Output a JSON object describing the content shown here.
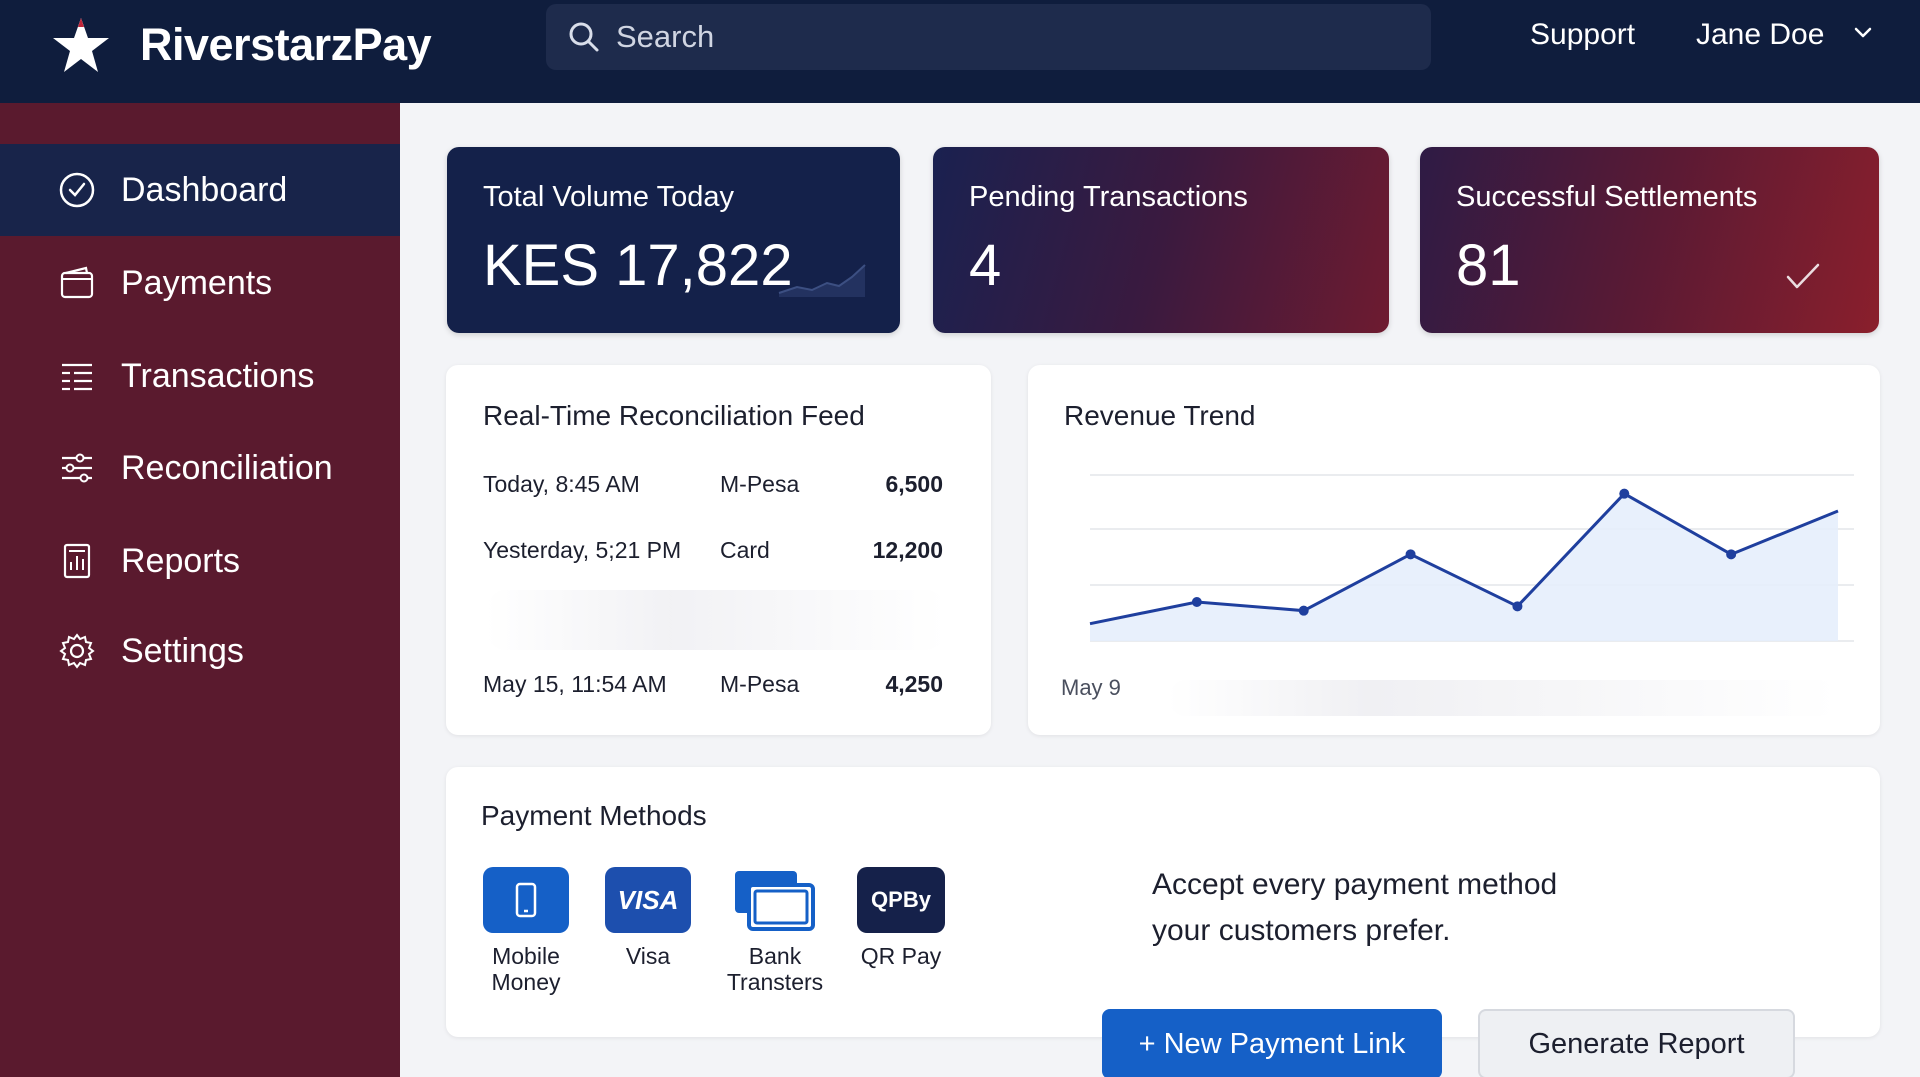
{
  "app": {
    "name": "RiverstarzPay"
  },
  "header": {
    "search_placeholder": "Search",
    "support_label": "Support",
    "user_name": "Jane Doe"
  },
  "sidebar": {
    "items": [
      {
        "label": "Dashboard",
        "icon": "check-circle-icon",
        "active": true
      },
      {
        "label": "Payments",
        "icon": "wallet-icon"
      },
      {
        "label": "Transactions",
        "icon": "list-icon"
      },
      {
        "label": "Reconciliation",
        "icon": "sliders-icon"
      },
      {
        "label": "Reports",
        "icon": "report-icon"
      },
      {
        "label": "Settings",
        "icon": "gear-icon"
      }
    ]
  },
  "stats": [
    {
      "title": "Total Volume Today",
      "value": "KES 17,822"
    },
    {
      "title": "Pending Transactions",
      "value": "4"
    },
    {
      "title": "Successful Settlements",
      "value": "81"
    }
  ],
  "feed": {
    "title": "Real-Time Reconciliation Feed",
    "rows": [
      {
        "time": "Today, 8:45 AM",
        "method": "M-Pesa",
        "amount": "6,500"
      },
      {
        "time": "Yesterday, 5;21 PM",
        "method": "Card",
        "amount": "12,200"
      },
      {
        "time": "May 15, 11:54 AM",
        "method": "M-Pesa",
        "amount": "4,250"
      }
    ]
  },
  "revenue": {
    "title": "Revenue Trend",
    "x_label": "May 9",
    "values": [
      2,
      4.5,
      3.5,
      10,
      4,
      17,
      10,
      15
    ]
  },
  "payment_methods": {
    "title": "Payment Methods",
    "items": [
      {
        "label_line1": "Mobile",
        "label_line2": "Money",
        "icon": "mobile-phone-icon"
      },
      {
        "label_line1": "Visa",
        "label_line2": "",
        "icon": "visa-icon",
        "badge": "VISA"
      },
      {
        "label_line1": "Bank",
        "label_line2": "Transters",
        "icon": "bank-cards-icon"
      },
      {
        "label_line1": "QR Pay",
        "label_line2": "",
        "icon": "qr-pay-icon",
        "badge": "QPBy"
      }
    ],
    "tagline_line1": "Accept every payment method",
    "tagline_line2": "your customers prefer."
  },
  "actions": {
    "new_link_label": "+ New Payment Link",
    "report_label": "Generate Report"
  },
  "colors": {
    "topbar": "#0f1d3d",
    "sidebar": "#5a1a2e",
    "active_nav": "#18244a",
    "primary": "#1560c7",
    "chart_line": "#1f3f9e"
  }
}
